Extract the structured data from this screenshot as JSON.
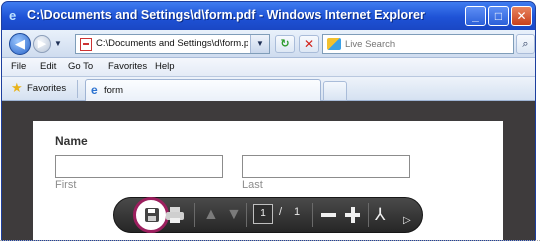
{
  "window": {
    "title": "C:\\Documents and Settings\\d\\form.pdf - Windows Internet Explorer",
    "icon": "ie-logo-icon",
    "buttons": [
      "minimize",
      "maximize",
      "close"
    ]
  },
  "navigation": {
    "address": "C:\\Documents and Settings\\d\\form.pdf",
    "search_placeholder": "Live Search"
  },
  "menu": {
    "items": [
      "File",
      "Edit",
      "Go To",
      "Favorites",
      "Help"
    ]
  },
  "favorites": {
    "label": "Favorites",
    "tab_title": "form"
  },
  "form": {
    "name_label": "Name",
    "first_label": "First",
    "last_label": "Last"
  },
  "pdf_toolbar": {
    "current_page": "1",
    "separator": "/",
    "total_pages": "1",
    "highlight_color": "#9c1f5e"
  }
}
